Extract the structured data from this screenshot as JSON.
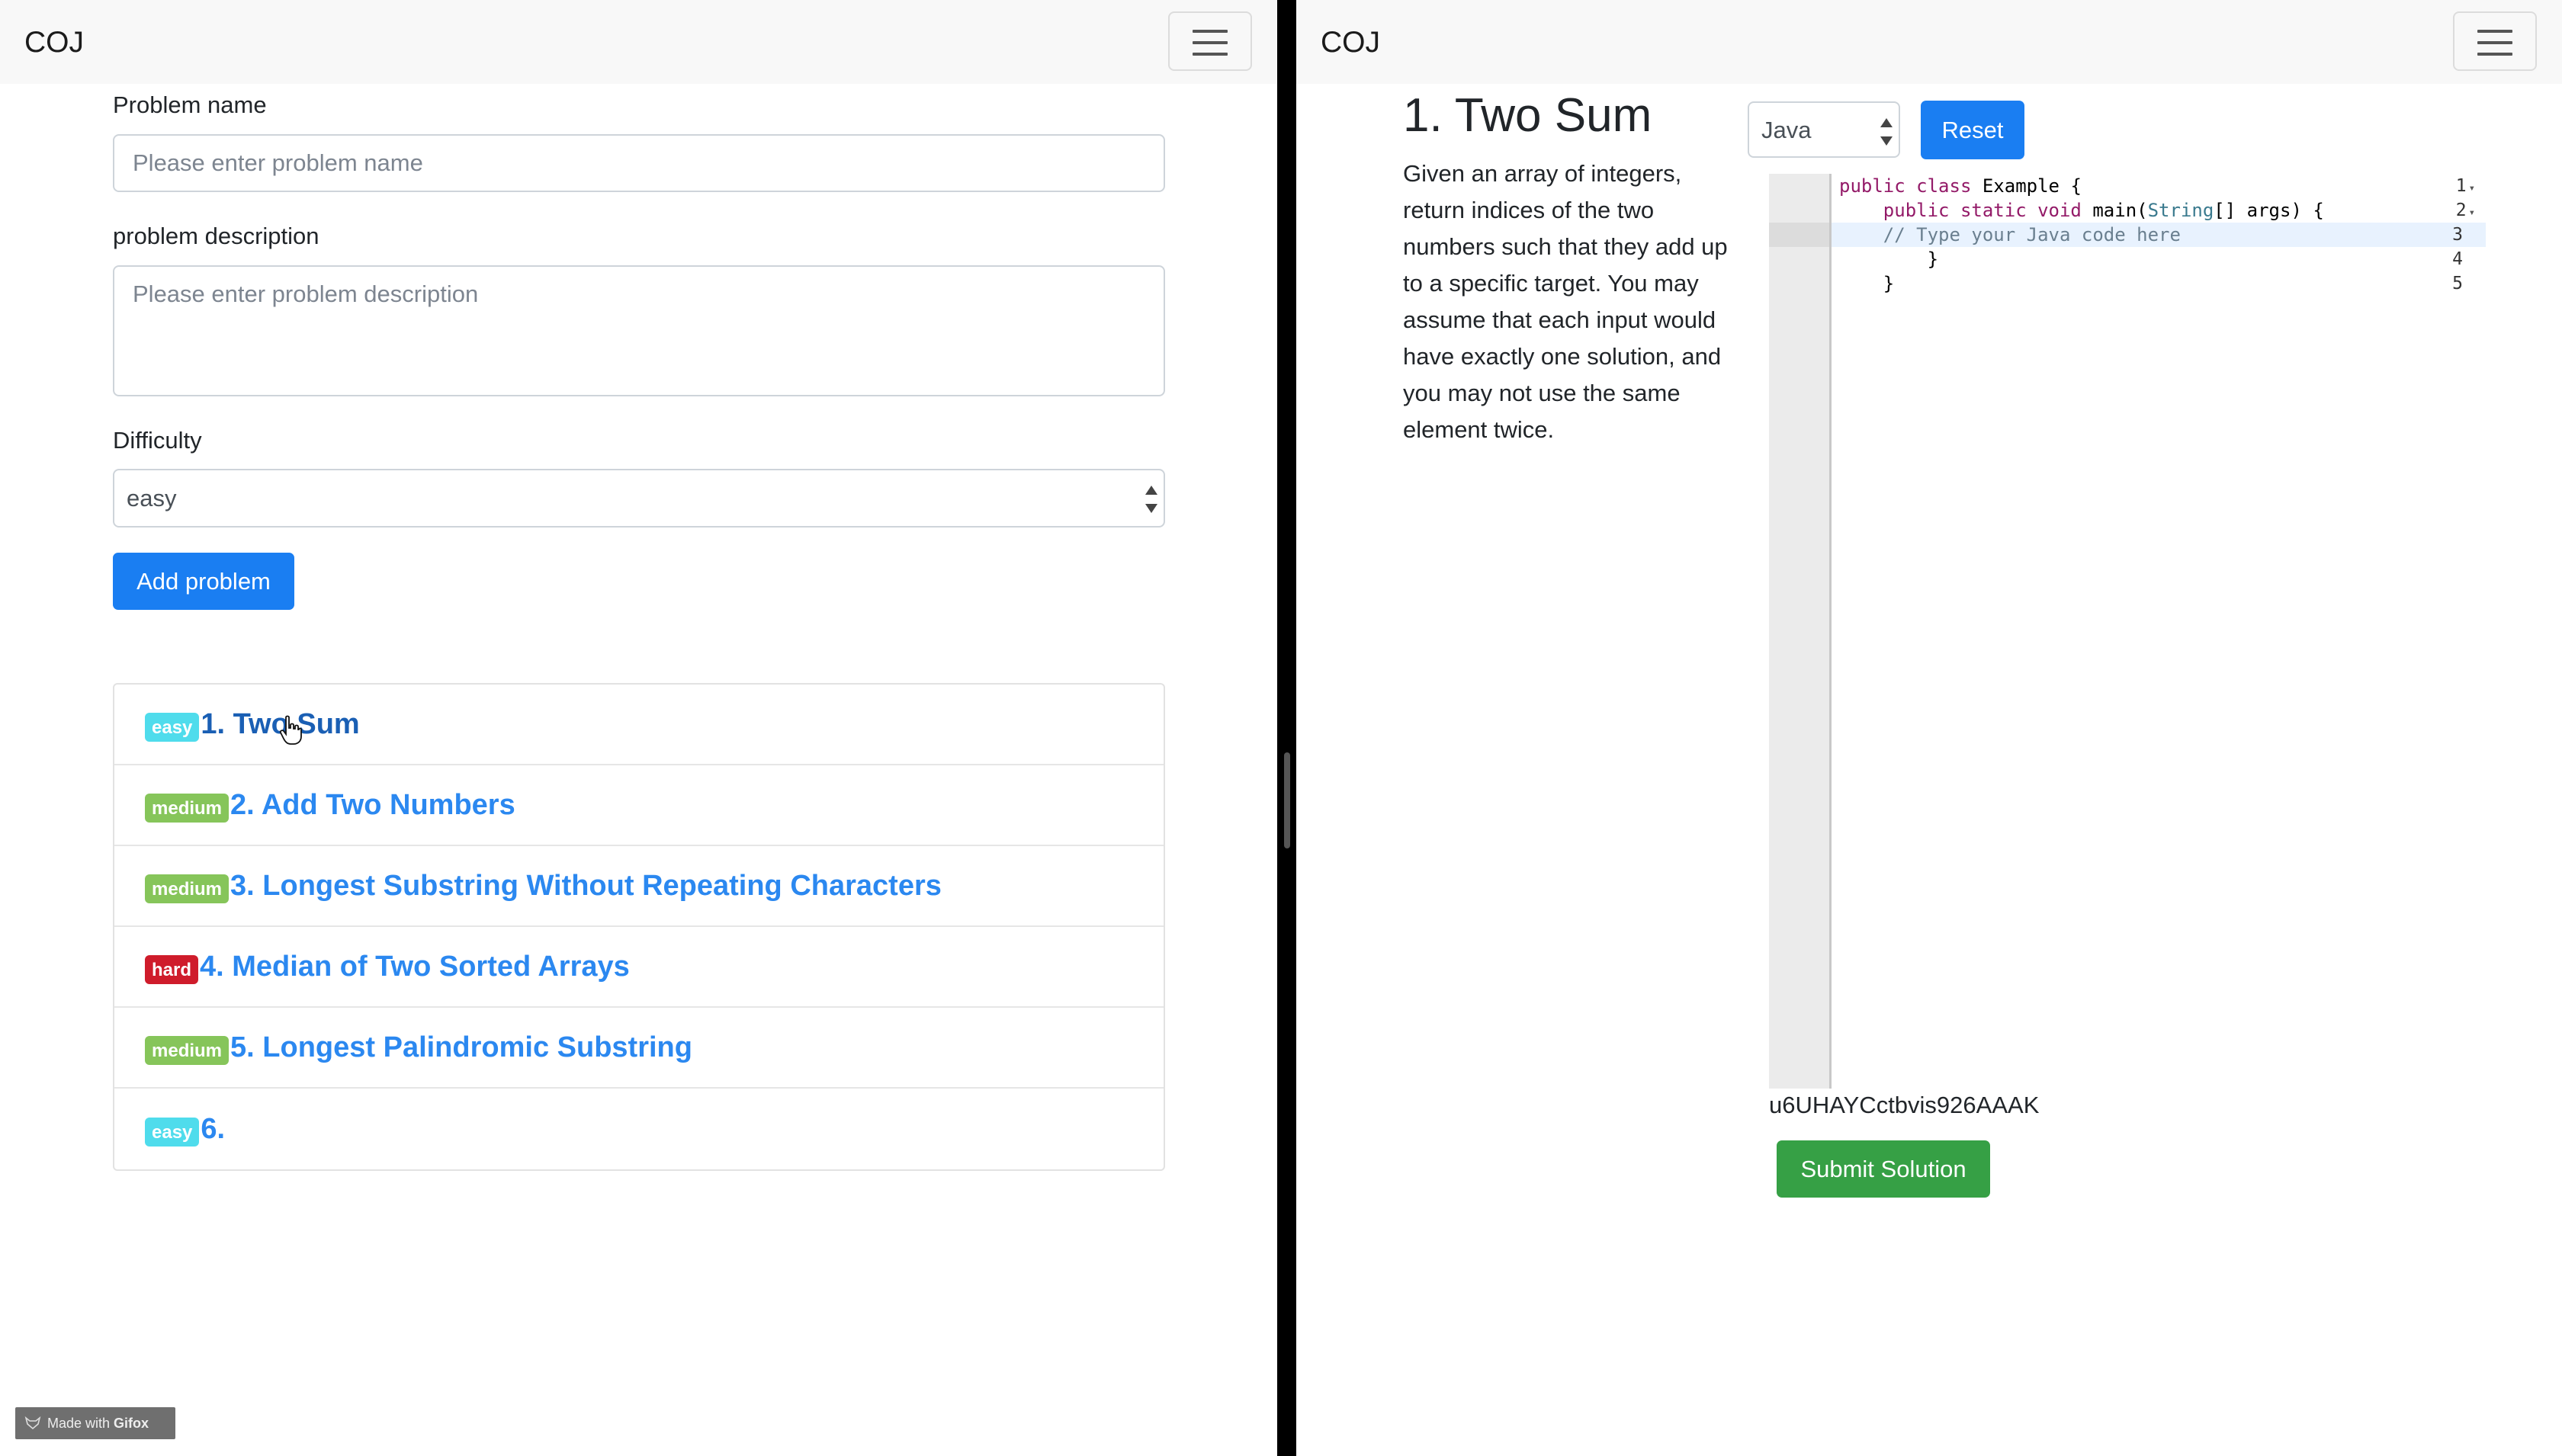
{
  "left": {
    "brand": "COJ",
    "form": {
      "name_label": "Problem name",
      "name_placeholder": "Please enter problem name",
      "desc_label": "problem description",
      "desc_placeholder": "Please enter problem description",
      "difficulty_label": "Difficulty",
      "difficulty_value": "easy",
      "add_button": "Add problem"
    },
    "problems": [
      {
        "difficulty": "easy",
        "title": "1. Two Sum"
      },
      {
        "difficulty": "medium",
        "title": "2. Add Two Numbers"
      },
      {
        "difficulty": "medium",
        "title": "3. Longest Substring Without Repeating Characters"
      },
      {
        "difficulty": "hard",
        "title": "4. Median of Two Sorted Arrays"
      },
      {
        "difficulty": "medium",
        "title": "5. Longest Palindromic Substring"
      },
      {
        "difficulty": "easy",
        "title": "6."
      }
    ],
    "watermark": {
      "prefix": "Made with",
      "brand": "Gifox"
    }
  },
  "right": {
    "brand": "COJ",
    "problem_title": "1. Two Sum",
    "problem_description": "Given an array of integers, return indices of the two numbers such that they add up to a specific target. You may assume that each input would have exactly one solution, and you may not use the same element twice.",
    "language": "Java",
    "reset_button": "Reset",
    "editor": {
      "line_numbers": [
        "1",
        "2",
        "3",
        "4",
        "5"
      ],
      "code": {
        "l1a": "public class ",
        "l1b": "Example {",
        "l2a": "    public static void ",
        "l2b": "main(",
        "l2c": "String",
        "l2d": "[] args) {",
        "l3": "    // Type your Java code here",
        "l4": "        }",
        "l5": "    }"
      }
    },
    "session_token": "u6UHAYCctbvis926AAAK",
    "submit_button": "Submit Solution"
  },
  "colors": {
    "primary": "#1a7ef2",
    "success": "#36a045",
    "badge_easy": "#4fdcec",
    "badge_medium": "#86c55a",
    "badge_hard": "#cf1c2b",
    "link": "#2b88f0"
  }
}
